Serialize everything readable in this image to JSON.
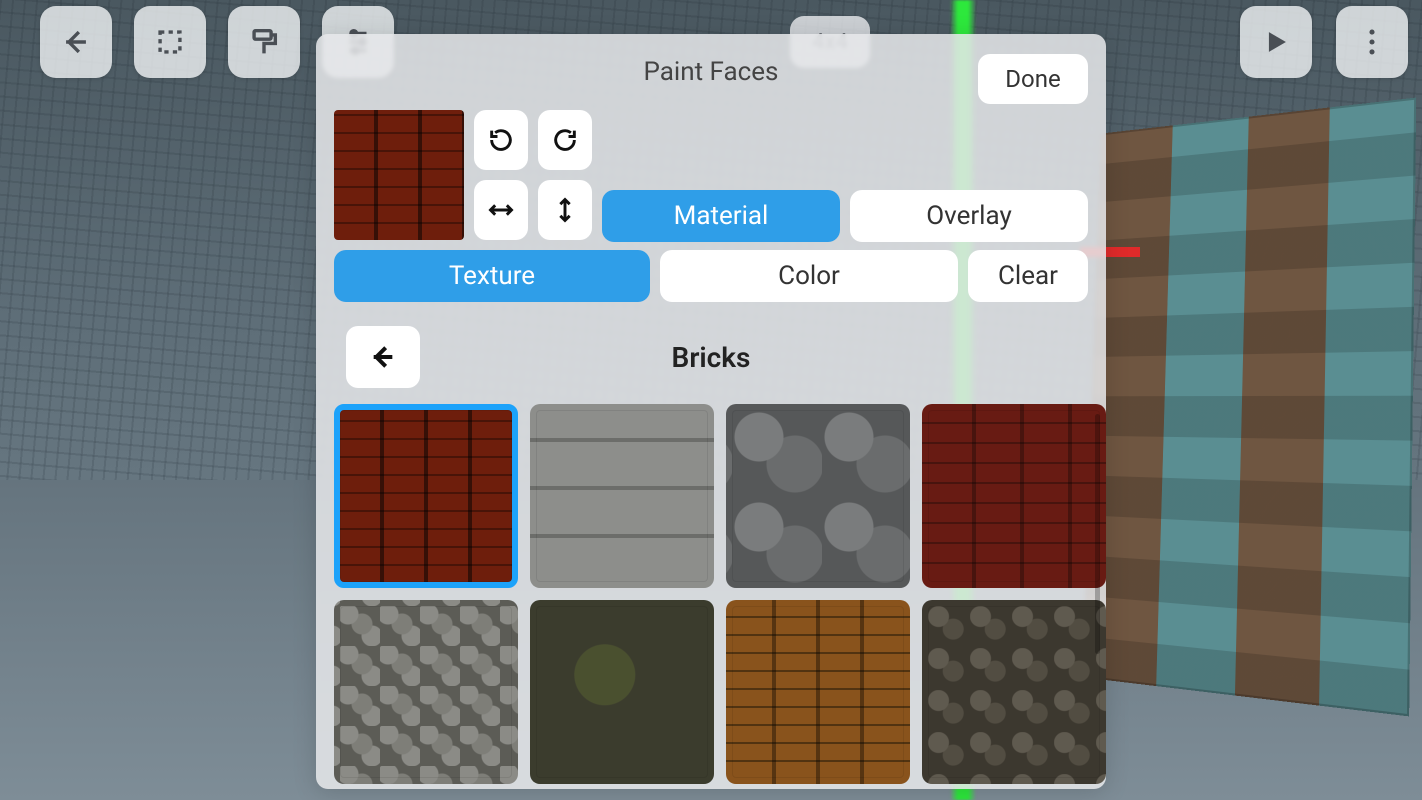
{
  "toolbar": {
    "grid_label": "4x4"
  },
  "panel": {
    "title": "Paint Faces",
    "done": "Done",
    "toggle": {
      "material": "Material",
      "overlay": "Overlay"
    },
    "mode": {
      "texture": "Texture",
      "color": "Color",
      "clear": "Clear"
    },
    "category": "Bricks",
    "textures": [
      {
        "name": "brick-red",
        "selected": true
      },
      {
        "name": "concrete-block",
        "selected": false
      },
      {
        "name": "stone",
        "selected": false
      },
      {
        "name": "paver-red",
        "selected": false
      },
      {
        "name": "cobble",
        "selected": false
      },
      {
        "name": "moss",
        "selected": false
      },
      {
        "name": "brick-yellow",
        "selected": false
      },
      {
        "name": "cobble-dark",
        "selected": false
      }
    ],
    "selected_texture": "brick-red",
    "active_layer": "material",
    "active_mode": "texture"
  }
}
